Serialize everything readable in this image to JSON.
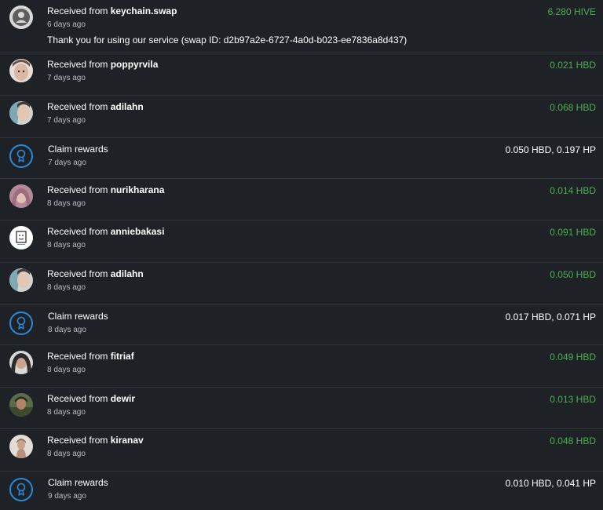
{
  "colors": {
    "background": "#1e2226",
    "received_amount": "#4caf50",
    "claim_icon": "#2a8ad8",
    "separator": "#2e3338"
  },
  "transactions": [
    {
      "type": "received",
      "prefix": "Received from ",
      "user": "keychain.swap",
      "time": "6 days ago",
      "memo": "Thank you for using our service (swap ID: d2b97a2e-6727-4a0d-b023-ee7836a8d437)",
      "amount": "6.280 HIVE",
      "avatar": "default-user-icon"
    },
    {
      "type": "received",
      "prefix": "Received from ",
      "user": "poppyrvila",
      "time": "7 days ago",
      "amount": "0.021 HBD",
      "avatar": "user-avatar"
    },
    {
      "type": "received",
      "prefix": "Received from ",
      "user": "adilahn",
      "time": "7 days ago",
      "amount": "0.068 HBD",
      "avatar": "user-avatar"
    },
    {
      "type": "claim",
      "label": "Claim rewards",
      "time": "7 days ago",
      "amount": "0.050 HBD, 0.197 HP",
      "icon": "award-icon"
    },
    {
      "type": "received",
      "prefix": "Received from ",
      "user": "nurikharana",
      "time": "8 days ago",
      "amount": "0.014 HBD",
      "avatar": "user-avatar"
    },
    {
      "type": "received",
      "prefix": "Received from ",
      "user": "anniebakasi",
      "time": "8 days ago",
      "amount": "0.091 HBD",
      "avatar": "user-avatar"
    },
    {
      "type": "received",
      "prefix": "Received from ",
      "user": "adilahn",
      "time": "8 days ago",
      "amount": "0.050 HBD",
      "avatar": "user-avatar"
    },
    {
      "type": "claim",
      "label": "Claim rewards",
      "time": "8 days ago",
      "amount": "0.017 HBD, 0.071 HP",
      "icon": "award-icon"
    },
    {
      "type": "received",
      "prefix": "Received from ",
      "user": "fitriaf",
      "time": "8 days ago",
      "amount": "0.049 HBD",
      "avatar": "user-avatar"
    },
    {
      "type": "received",
      "prefix": "Received from ",
      "user": "dewir",
      "time": "8 days ago",
      "amount": "0.013 HBD",
      "avatar": "user-avatar"
    },
    {
      "type": "received",
      "prefix": "Received from ",
      "user": "kiranav",
      "time": "8 days ago",
      "amount": "0.048 HBD",
      "avatar": "user-avatar"
    },
    {
      "type": "claim",
      "label": "Claim rewards",
      "time": "9 days ago",
      "amount": "0.010 HBD, 0.041 HP",
      "icon": "award-icon"
    }
  ]
}
